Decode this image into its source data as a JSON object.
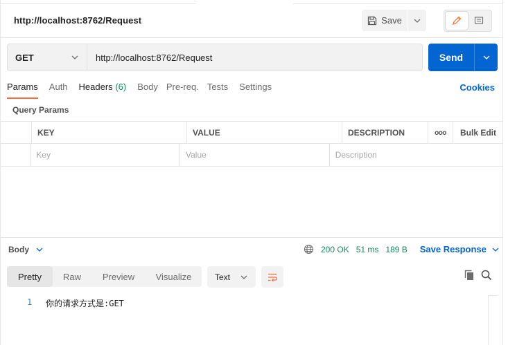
{
  "header": {
    "title": "http://localhost:8762/Request",
    "save_label": "Save"
  },
  "request": {
    "method": "GET",
    "url": "http://localhost:8762/Request",
    "send_label": "Send"
  },
  "tabs": [
    {
      "label": "Params",
      "active": true
    },
    {
      "label": "Auth"
    },
    {
      "label": "Headers",
      "count": "(6)"
    },
    {
      "label": "Body"
    },
    {
      "label": "Pre-req."
    },
    {
      "label": "Tests"
    },
    {
      "label": "Settings"
    }
  ],
  "cookies_label": "Cookies",
  "query_params": {
    "title": "Query Params",
    "columns": [
      "KEY",
      "VALUE",
      "DESCRIPTION"
    ],
    "more_label": "ooo",
    "bulk_edit_label": "Bulk Edit",
    "placeholders": {
      "key": "Key",
      "value": "Value",
      "description": "Description"
    }
  },
  "response": {
    "body_label": "Body",
    "status": "200 OK",
    "time": "51 ms",
    "size": "189 B",
    "save_response_label": "Save Response",
    "view_tabs": [
      "Pretty",
      "Raw",
      "Preview",
      "Visualize"
    ],
    "active_view": "Pretty",
    "format": "Text",
    "lines": [
      {
        "number": "1",
        "text": "你的请求方式是:GET"
      }
    ]
  },
  "colors": {
    "accent_orange": "#ff6c37",
    "send_blue": "#0265d2",
    "status_green": "#0f8c5a"
  },
  "icons": [
    "save-icon",
    "chevron-down-icon",
    "pencil-icon",
    "comment-icon",
    "globe-icon",
    "wrap-lines-icon",
    "copy-icon",
    "search-icon"
  ]
}
